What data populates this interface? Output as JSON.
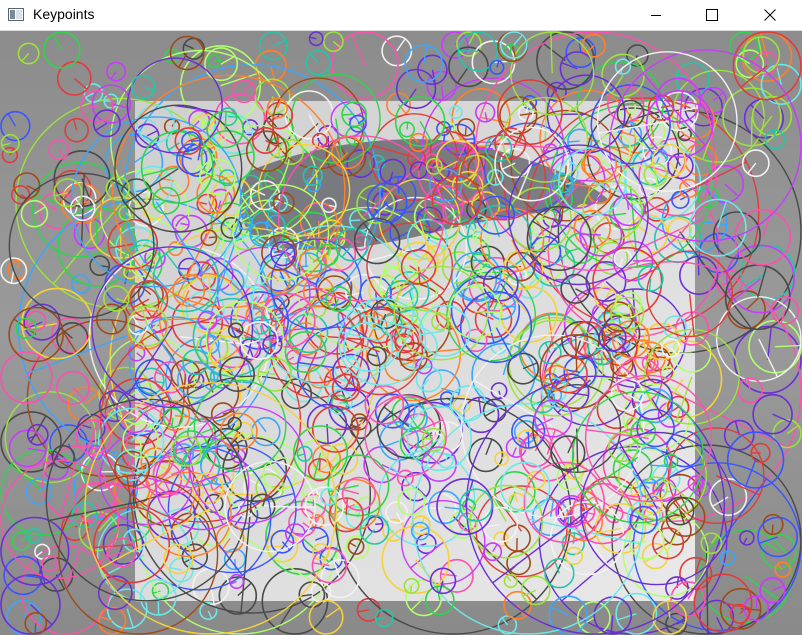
{
  "window": {
    "title": "Keypoints",
    "icons": {
      "app": "image-window-icon",
      "minimize": "minimize-icon",
      "maximize": "maximize-icon",
      "close": "close-icon"
    }
  },
  "image": {
    "description_name": "keypoints-visualization",
    "palette": [
      "#e23b3b",
      "#ff7f2a",
      "#f6d23a",
      "#9be33b",
      "#2fd54a",
      "#23c7a8",
      "#39a7ff",
      "#3a55ff",
      "#6b2fd6",
      "#c83bff",
      "#ff4fb0",
      "#f2f2f2",
      "#4a4a4a",
      "#a04a18",
      "#6be8e8",
      "#b0ff6b"
    ],
    "keypoint_count": 900
  }
}
